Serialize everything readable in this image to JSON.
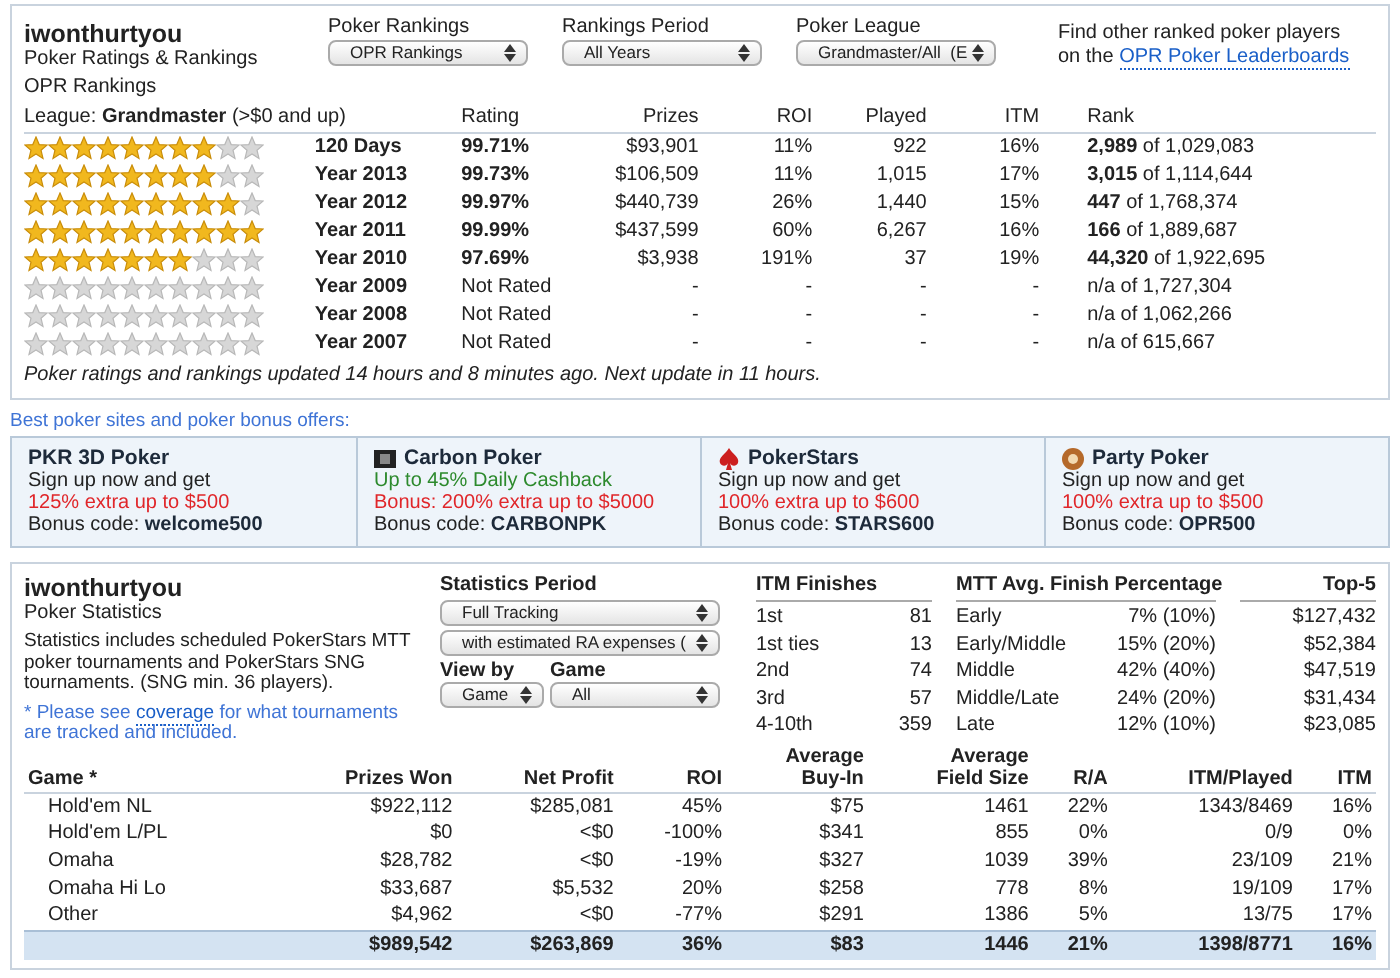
{
  "header": {
    "player": "iwonthurtyou",
    "subtitle": "Poker Ratings & Rankings"
  },
  "filters": [
    {
      "label": "Poker Rankings",
      "value": "OPR Rankings"
    },
    {
      "label": "Rankings Period",
      "value": "All Years"
    },
    {
      "label": "Poker League",
      "value": "Grandmaster/All  (E"
    }
  ],
  "leaderboard_note": {
    "text": "Find other ranked poker players",
    "prefix": "on the",
    "link": "OPR Poker Leaderboards"
  },
  "rankings": {
    "title": "OPR Rankings",
    "league": "League: **Grandmaster** (>$0 and up)",
    "columns": [
      "Rating",
      "Prizes",
      "ROI",
      "Played",
      "ITM",
      "Rank"
    ],
    "rows": [
      {
        "stars": 8,
        "period": "120 Days",
        "rated": true,
        "rating": "99.71%",
        "prizes": "$93,901",
        "roi": "11%",
        "played": "922",
        "itm": "16%",
        "rank": "**2,989** of 1,029,083"
      },
      {
        "stars": 8,
        "period": "Year 2013",
        "rated": true,
        "rating": "99.73%",
        "prizes": "$106,509",
        "roi": "11%",
        "played": "1,015",
        "itm": "17%",
        "rank": "**3,015** of 1,114,644"
      },
      {
        "stars": 9,
        "period": "Year 2012",
        "rated": true,
        "rating": "99.97%",
        "prizes": "$440,739",
        "roi": "26%",
        "played": "1,440",
        "itm": "15%",
        "rank": "**447** of 1,768,374"
      },
      {
        "stars": 10,
        "period": "Year 2011",
        "rated": true,
        "rating": "99.99%",
        "prizes": "$437,599",
        "roi": "60%",
        "played": "6,267",
        "itm": "16%",
        "rank": "**166** of 1,889,687"
      },
      {
        "stars": 7,
        "period": "Year 2010",
        "rated": true,
        "rating": "97.69%",
        "prizes": "$3,938",
        "roi": "191%",
        "played": "37",
        "itm": "19%",
        "rank": "**44,320** of 1,922,695"
      },
      {
        "stars": 0,
        "period": "Year 2009",
        "rated": false,
        "rating": "Not Rated",
        "prizes": "-",
        "roi": "-",
        "played": "-",
        "itm": "-",
        "rank": "n/a of 1,727,304"
      },
      {
        "stars": 0,
        "period": "Year 2008",
        "rated": false,
        "rating": "Not Rated",
        "prizes": "-",
        "roi": "-",
        "played": "-",
        "itm": "-",
        "rank": "n/a of 1,062,266"
      },
      {
        "stars": 0,
        "period": "Year 2007",
        "rated": false,
        "rating": "Not Rated",
        "prizes": "-",
        "roi": "-",
        "played": "-",
        "itm": "-",
        "rank": "n/a of 615,667"
      }
    ],
    "footer": "Poker ratings and rankings updated 14 hours and 8 minutes ago. Next update in 11 hours."
  },
  "offers": {
    "heading": "Best poker sites and poker bonus offers:",
    "items": [
      {
        "name": "PKR 3D Poker",
        "tagline": "Sign up now and get",
        "tagline_highlight": false,
        "bonus": "125% extra up to $500",
        "code_label": "Bonus code:",
        "code": "welcome500"
      },
      {
        "kind": "card",
        "name": "Carbon Poker",
        "tagline": "Up to 45% Daily Cashback",
        "tagline_highlight": true,
        "bonus": "Bonus:  200% extra up to $5000",
        "code_label": "Bonus code:",
        "code": "CARBONPK"
      },
      {
        "kind": "spade",
        "name": "PokerStars",
        "tagline": "Sign up now and get",
        "tagline_highlight": false,
        "bonus": "100% extra up to $600",
        "code_label": "Bonus code:",
        "code": "STARS600"
      },
      {
        "kind": "chip",
        "name": "Party Poker",
        "tagline": "Sign up now and get",
        "tagline_highlight": false,
        "bonus": "100% extra up to $500",
        "code_label": "Bonus code:",
        "code": "OPR500"
      }
    ]
  },
  "statistics": {
    "player": "iwonthurtyou",
    "subtitle": "Poker Statistics",
    "description": "Statistics includes scheduled PokerStars MTT poker tournaments and PokerStars SNG tournaments. (SNG min. 36 players).",
    "note": {
      "before": "* Please see",
      "link": "coverage",
      "after": "for what tournaments are tracked and included."
    },
    "controls": {
      "period_label": "Statistics Period",
      "period": "Full Tracking",
      "expenses": "with estimated RA expenses (",
      "view_label": "View by",
      "view": "Game",
      "game_label": "Game",
      "game": "All"
    },
    "itm_finishes": {
      "title": "ITM Finishes",
      "rows": [
        {
          "place": "1st",
          "count": "81"
        },
        {
          "place": "1st ties",
          "count": "13"
        },
        {
          "place": "2nd",
          "count": "74"
        },
        {
          "place": "3rd",
          "count": "57"
        },
        {
          "place": "4-10th",
          "count": "359"
        }
      ]
    },
    "finish_pct": {
      "title": "MTT Avg. Finish Percentage",
      "rows": [
        {
          "stage": "Early",
          "pct": "7% (10%)"
        },
        {
          "stage": "Early/Middle",
          "pct": "15% (20%)"
        },
        {
          "stage": "Middle",
          "pct": "42% (40%)"
        },
        {
          "stage": "Middle/Late",
          "pct": "24% (20%)"
        },
        {
          "stage": "Late",
          "pct": "12% (10%)"
        }
      ]
    },
    "top5": {
      "title": "Top-5",
      "values": [
        "$127,432",
        "$52,384",
        "$47,519",
        "$31,434",
        "$23,085"
      ]
    },
    "table": {
      "columns": [
        "Game *",
        "Prizes Won",
        "Net Profit",
        "ROI",
        "Average\nBuy-In",
        "Average\nField Size",
        "R/A",
        "ITM/Played",
        "ITM"
      ],
      "rows": [
        {
          "cells": [
            "Hold'em NL",
            "$922,112",
            "$285,081",
            "45%",
            "$75",
            "1461",
            "22%",
            "1343/8469",
            "16%"
          ]
        },
        {
          "cells": [
            "Hold'em L/PL",
            "$0",
            "<$0",
            "-100%",
            "$341",
            "855",
            "0%",
            "0/9",
            "0%"
          ]
        },
        {
          "cells": [
            "Omaha",
            "$28,782",
            "<$0",
            "-19%",
            "$327",
            "1039",
            "39%",
            "23/109",
            "21%"
          ]
        },
        {
          "cells": [
            "Omaha Hi Lo",
            "$33,687",
            "$5,532",
            "20%",
            "$258",
            "778",
            "8%",
            "19/109",
            "17%"
          ]
        },
        {
          "cells": [
            "Other",
            "$4,962",
            "<$0",
            "-77%",
            "$291",
            "1386",
            "5%",
            "13/75",
            "17%"
          ]
        }
      ],
      "total": [
        "$989,542",
        "$263,869",
        "36%",
        "$83",
        "1446",
        "21%",
        "1398/8771",
        "16%"
      ]
    }
  }
}
